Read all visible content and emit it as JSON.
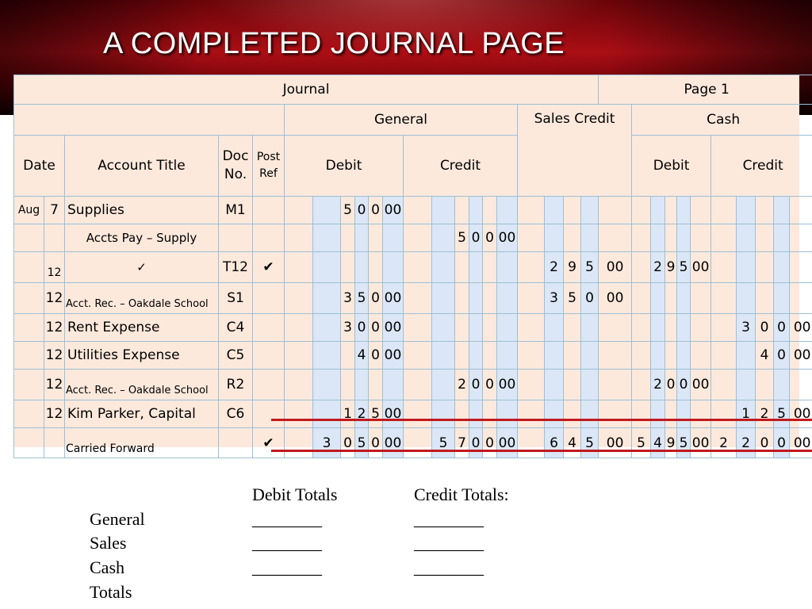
{
  "title": "A COMPLETED JOURNAL PAGE",
  "journal": {
    "name": "Journal",
    "page": "Page 1",
    "general_header": "General",
    "sales_credit_header": "Sales Credit",
    "cash_header": "Cash",
    "columns": {
      "date": "Date",
      "account_title": "Account Title",
      "doc_no": "Doc No.",
      "post_ref": "Post Ref",
      "debit": "Debit",
      "credit": "Credit"
    },
    "rows": [
      {
        "month": "Aug",
        "day": "7",
        "account": "Supplies",
        "doc": "M1",
        "post": "",
        "gen_debit": [
          "5",
          "0",
          "0",
          "00"
        ],
        "gen_credit": [
          "",
          "",
          "",
          ""
        ],
        "sales_credit": [
          "",
          "",
          "",
          ""
        ],
        "cash_debit": [
          "",
          "",
          "",
          ""
        ],
        "cash_credit": [
          "",
          "",
          "",
          ""
        ]
      },
      {
        "month": "",
        "day": "",
        "account": "Accts Pay – Supply",
        "doc": "",
        "post": "",
        "gen_debit": [
          "",
          "",
          "",
          ""
        ],
        "gen_credit": [
          "5",
          "0",
          "0",
          "00"
        ],
        "sales_credit": [
          "",
          "",
          "",
          ""
        ],
        "cash_debit": [
          "",
          "",
          "",
          ""
        ],
        "cash_credit": [
          "",
          "",
          "",
          ""
        ]
      },
      {
        "month": "",
        "day": "12",
        "account": "✓",
        "doc": "T12",
        "post": "✔",
        "gen_debit": [
          "",
          "",
          "",
          ""
        ],
        "gen_credit": [
          "",
          "",
          "",
          ""
        ],
        "sales_credit": [
          "2",
          "9",
          "5",
          "00"
        ],
        "cash_debit": [
          "2",
          "9",
          "5",
          "00"
        ],
        "cash_credit": [
          "",
          "",
          "",
          ""
        ]
      },
      {
        "month": "",
        "day": "12",
        "account": "Acct. Rec. – Oakdale School",
        "doc": "S1",
        "post": "",
        "gen_debit": [
          "3",
          "5",
          "0",
          "00"
        ],
        "gen_credit": [
          "",
          "",
          "",
          ""
        ],
        "sales_credit": [
          "3",
          "5",
          "0",
          "00"
        ],
        "cash_debit": [
          "",
          "",
          "",
          ""
        ],
        "cash_credit": [
          "",
          "",
          "",
          ""
        ]
      },
      {
        "month": "",
        "day": "12",
        "account": "Rent Expense",
        "doc": "C4",
        "post": "",
        "gen_debit": [
          "3",
          "0",
          "0",
          "00"
        ],
        "gen_credit": [
          "",
          "",
          "",
          ""
        ],
        "sales_credit": [
          "",
          "",
          "",
          ""
        ],
        "cash_debit": [
          "",
          "",
          "",
          ""
        ],
        "cash_credit": [
          "3",
          "0",
          "0",
          "00"
        ]
      },
      {
        "month": "",
        "day": "12",
        "account": "Utilities Expense",
        "doc": "C5",
        "post": "",
        "gen_debit": [
          "",
          "4",
          "0",
          "00"
        ],
        "gen_credit": [
          "",
          "",
          "",
          ""
        ],
        "sales_credit": [
          "",
          "",
          "",
          ""
        ],
        "cash_debit": [
          "",
          "",
          "",
          ""
        ],
        "cash_credit": [
          "",
          "4",
          "0",
          "00"
        ]
      },
      {
        "month": "",
        "day": "12",
        "account": "Acct. Rec. – Oakdale School",
        "doc": "R2",
        "post": "",
        "gen_debit": [
          "",
          "",
          "",
          ""
        ],
        "gen_credit": [
          "2",
          "0",
          "0",
          "00"
        ],
        "sales_credit": [
          "",
          "",
          "",
          ""
        ],
        "cash_debit": [
          "2",
          "0",
          "0",
          "00"
        ],
        "cash_credit": [
          "",
          "",
          "",
          ""
        ]
      },
      {
        "month": "",
        "day": "12",
        "account": "Kim Parker, Capital",
        "doc": "C6",
        "post": "",
        "gen_debit": [
          "1",
          "2",
          "5",
          "00"
        ],
        "gen_credit": [
          "",
          "",
          "",
          ""
        ],
        "sales_credit": [
          "",
          "",
          "",
          ""
        ],
        "cash_debit": [
          "",
          "",
          "",
          ""
        ],
        "cash_credit": [
          "1",
          "2",
          "5",
          "00"
        ]
      }
    ],
    "carried_forward": {
      "account": "Carried Forward",
      "post": "✔",
      "gen_debit": [
        "3",
        "0",
        "5",
        "0",
        "00"
      ],
      "gen_credit": [
        "5",
        "7",
        "0",
        "0",
        "00"
      ],
      "sales_credit": [
        "6",
        "4",
        "5",
        "00"
      ],
      "cash_debit": [
        "5",
        "4",
        "9",
        "5",
        "00"
      ],
      "cash_credit": [
        "2",
        "2",
        "0",
        "0",
        "00"
      ]
    }
  },
  "totals": {
    "debit_header": "Debit Totals",
    "credit_header": "Credit Totals:",
    "labels": [
      "General",
      "Sales",
      "Cash",
      "Totals"
    ],
    "blank": "________"
  },
  "colors": {
    "banner": "#a50d15",
    "sheet": "#fde9dc",
    "money_column": "#dbe7f6",
    "rule": "#c11a1f"
  }
}
